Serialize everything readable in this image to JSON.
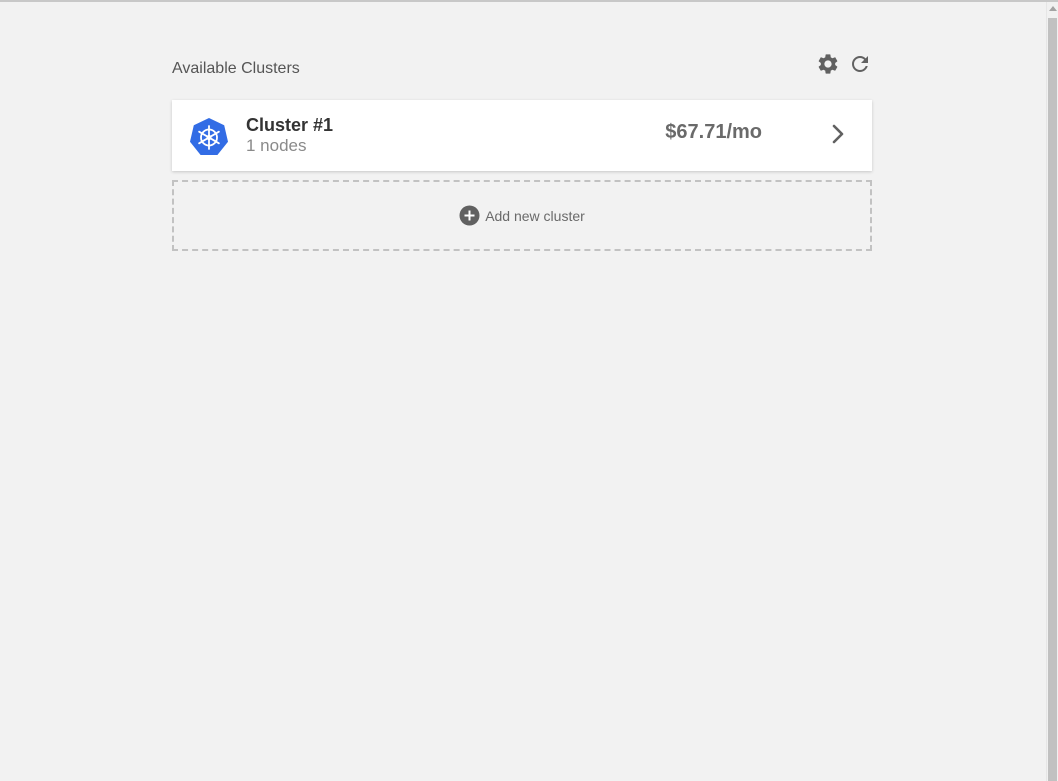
{
  "header": {
    "title": "Available Clusters",
    "actions": [
      {
        "icon": "gear-icon",
        "label": "Settings"
      },
      {
        "icon": "refresh-icon",
        "label": "Refresh"
      }
    ]
  },
  "clusters": [
    {
      "name": "Cluster #1",
      "nodes": "1 nodes",
      "price": "$67.71/mo",
      "logo_icon": "kubernetes-logo-icon"
    }
  ],
  "add_cluster": {
    "label": "Add new cluster",
    "icon": "plus-circle-icon"
  },
  "colors": {
    "background": "#f2f2f2",
    "card": "#ffffff",
    "kubernetes_blue": "#326ce5",
    "icon_gray": "#616161",
    "dashed_border": "#c2c2c2"
  }
}
